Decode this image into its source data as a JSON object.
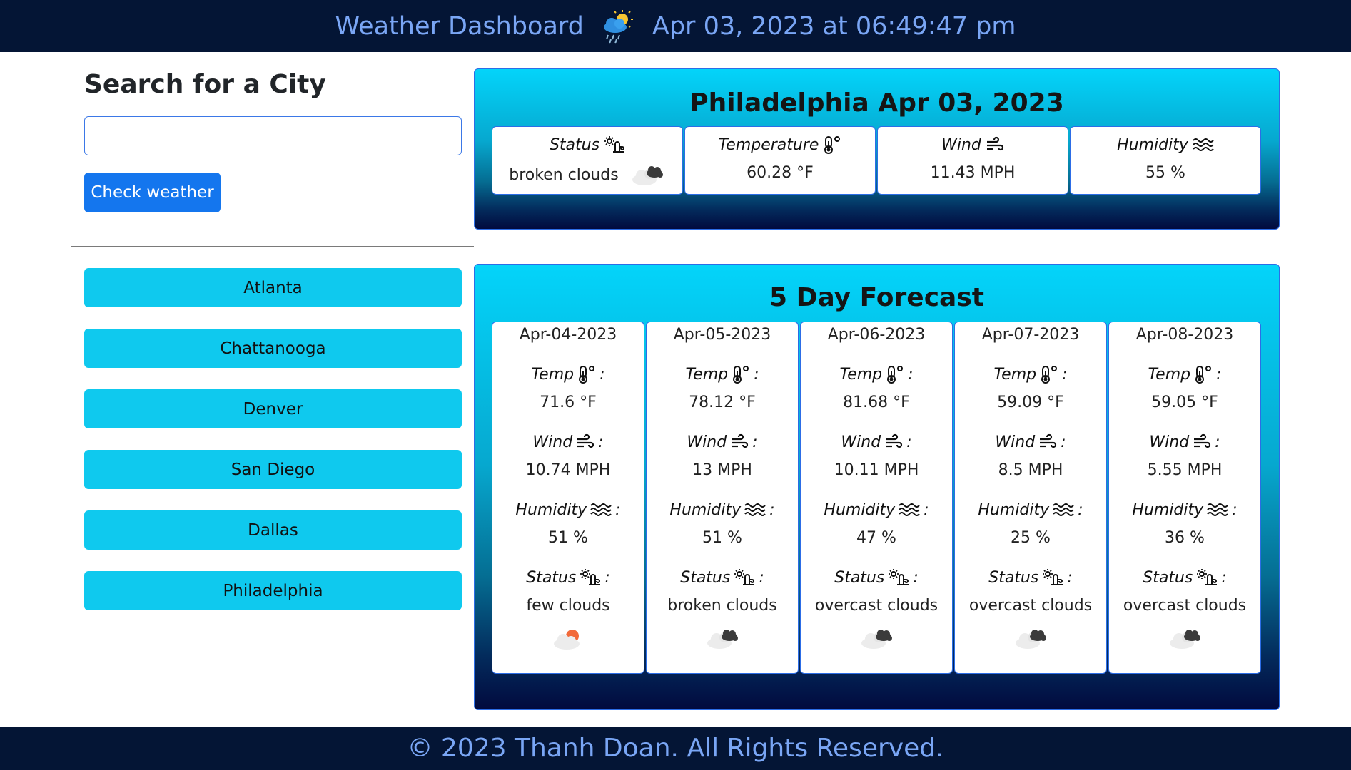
{
  "header": {
    "title": "Weather Dashboard",
    "datetime": "Apr 03, 2023 at 06:49:47 pm",
    "icon": "rain-sun-cloud-icon"
  },
  "search": {
    "title": "Search for a City",
    "input_value": "",
    "placeholder": "",
    "button_label": "Check weather"
  },
  "history": [
    "Atlanta",
    "Chattanooga",
    "Denver",
    "San Diego",
    "Dallas",
    "Philadelphia"
  ],
  "current": {
    "title": "Philadelphia Apr 03, 2023",
    "status_label": "Status",
    "status_value": "broken clouds",
    "temp_label": "Temperature",
    "temp_value": "60.28 °F",
    "wind_label": "Wind",
    "wind_value": "11.43 MPH",
    "humidity_label": "Humidity",
    "humidity_value": "55 %"
  },
  "forecast": {
    "title": "5 Day Forecast",
    "temp_label": "Temp",
    "wind_label": "Wind",
    "humidity_label": "Humidity",
    "status_label": "Status",
    "days": [
      {
        "date": "Apr-04-2023",
        "temp": "71.6 °F",
        "wind": "10.74 MPH",
        "humidity": "51 %",
        "status": "few clouds",
        "icon": "few-clouds-icon"
      },
      {
        "date": "Apr-05-2023",
        "temp": "78.12 °F",
        "wind": "13 MPH",
        "humidity": "51 %",
        "status": "broken clouds",
        "icon": "broken-clouds-icon"
      },
      {
        "date": "Apr-06-2023",
        "temp": "81.68 °F",
        "wind": "10.11 MPH",
        "humidity": "47 %",
        "status": "overcast clouds",
        "icon": "broken-clouds-icon"
      },
      {
        "date": "Apr-07-2023",
        "temp": "59.09 °F",
        "wind": "8.5 MPH",
        "humidity": "25 %",
        "status": "overcast clouds",
        "icon": "broken-clouds-icon"
      },
      {
        "date": "Apr-08-2023",
        "temp": "59.05 °F",
        "wind": "5.55 MPH",
        "humidity": "36 %",
        "status": "overcast clouds",
        "icon": "broken-clouds-icon"
      }
    ]
  },
  "footer": {
    "text": "© 2023 Thanh Doan. All Rights Reserved."
  },
  "colors": {
    "header_bg": "#041535",
    "header_text": "#7aa6f5",
    "primary_button": "#1476ee",
    "city_button": "#0fc9ee",
    "panel_top": "#04d4fa",
    "panel_bottom": "#020a3e"
  }
}
